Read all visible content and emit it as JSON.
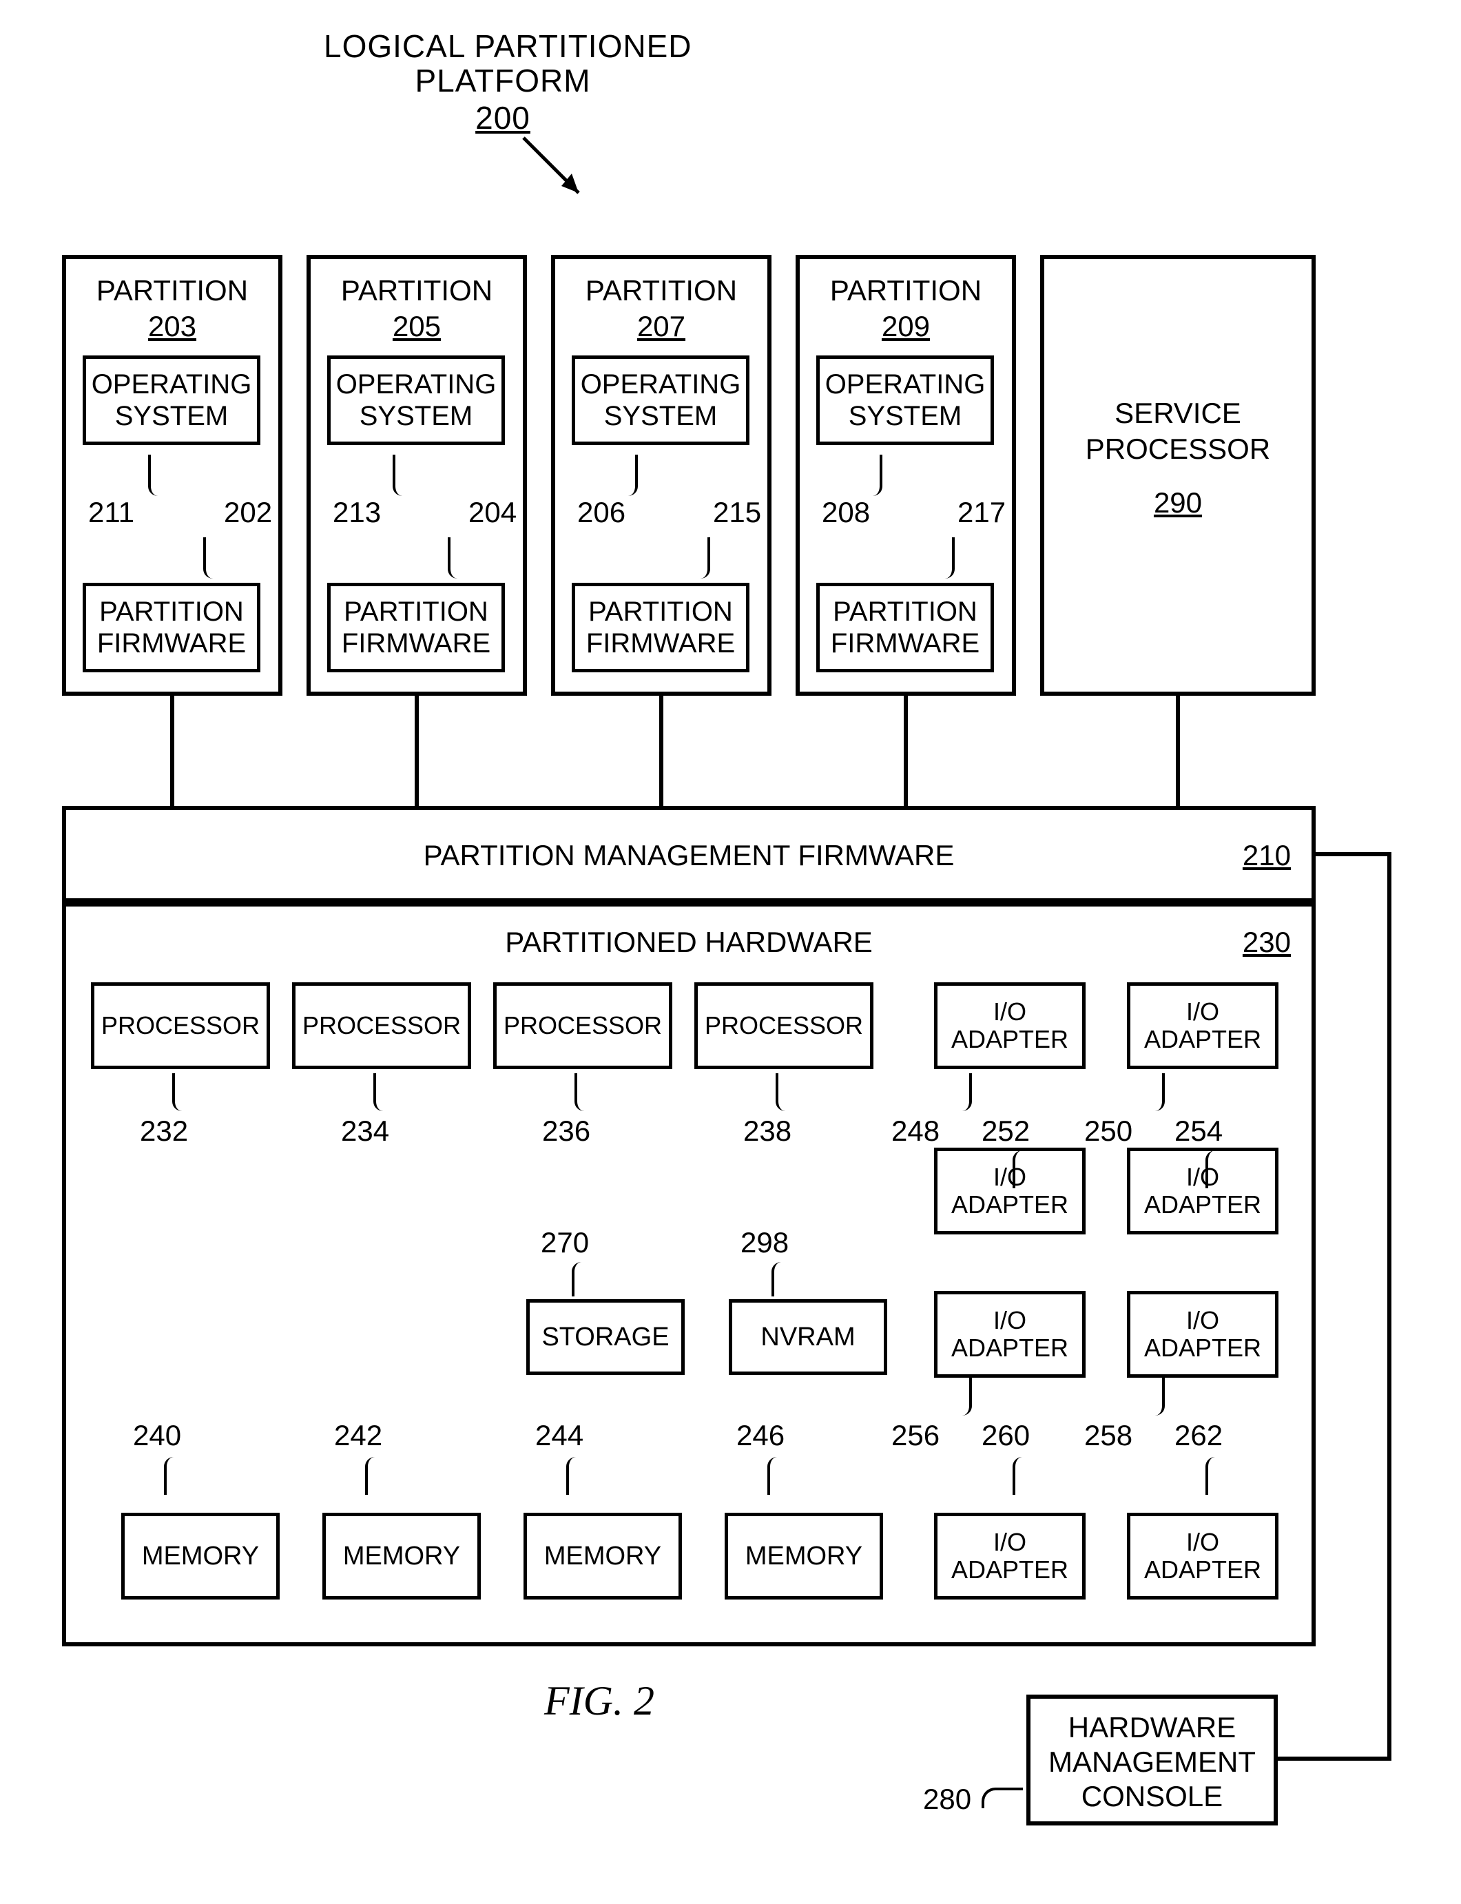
{
  "title": {
    "l1": "LOGICAL PARTITIONED",
    "l2": "PLATFORM",
    "ref": "200"
  },
  "partitions": [
    {
      "title": "PARTITION",
      "ref": "203",
      "os": "OPERATING\nSYSTEM",
      "osRef": "202",
      "fw": "PARTITION\nFIRMWARE",
      "fwRef": "211"
    },
    {
      "title": "PARTITION",
      "ref": "205",
      "os": "OPERATING\nSYSTEM",
      "osRef": "204",
      "fw": "PARTITION\nFIRMWARE",
      "fwRef": "213"
    },
    {
      "title": "PARTITION",
      "ref": "207",
      "os": "OPERATING\nSYSTEM",
      "osRef": "206",
      "fw": "PARTITION\nFIRMWARE",
      "fwRef": "215"
    },
    {
      "title": "PARTITION",
      "ref": "209",
      "os": "OPERATING\nSYSTEM",
      "osRef": "208",
      "fw": "PARTITION\nFIRMWARE",
      "fwRef": "217"
    }
  ],
  "service": {
    "l1": "SERVICE",
    "l2": "PROCESSOR",
    "ref": "290"
  },
  "pmf": {
    "label": "PARTITION MANAGEMENT FIRMWARE",
    "ref": "210"
  },
  "ph": {
    "label": "PARTITIONED HARDWARE",
    "ref": "230"
  },
  "processors": [
    {
      "label": "PROCESSOR",
      "ref": "232"
    },
    {
      "label": "PROCESSOR",
      "ref": "234"
    },
    {
      "label": "PROCESSOR",
      "ref": "236"
    },
    {
      "label": "PROCESSOR",
      "ref": "238"
    }
  ],
  "ioTop": [
    {
      "label": "I/O\nADAPTER",
      "ref": "248"
    },
    {
      "label": "I/O\nADAPTER",
      "ref": "250"
    }
  ],
  "ioRow2": [
    {
      "label": "I/O\nADAPTER",
      "ref": "252"
    },
    {
      "label": "I/O\nADAPTER",
      "ref": "254"
    }
  ],
  "storage": {
    "label": "STORAGE",
    "ref": "270"
  },
  "nvram": {
    "label": "NVRAM",
    "ref": "298"
  },
  "ioRow3": [
    {
      "label": "I/O\nADAPTER",
      "ref": "256"
    },
    {
      "label": "I/O\nADAPTER",
      "ref": "258"
    }
  ],
  "memories": [
    {
      "label": "MEMORY",
      "ref": "240"
    },
    {
      "label": "MEMORY",
      "ref": "242"
    },
    {
      "label": "MEMORY",
      "ref": "244"
    },
    {
      "label": "MEMORY",
      "ref": "246"
    }
  ],
  "ioRow4": [
    {
      "label": "I/O\nADAPTER",
      "ref": "260"
    },
    {
      "label": "I/O\nADAPTER",
      "ref": "262"
    }
  ],
  "hmc": {
    "l1": "HARDWARE",
    "l2": "MANAGEMENT",
    "l3": "CONSOLE",
    "ref": "280"
  },
  "figure": "FIG. 2"
}
